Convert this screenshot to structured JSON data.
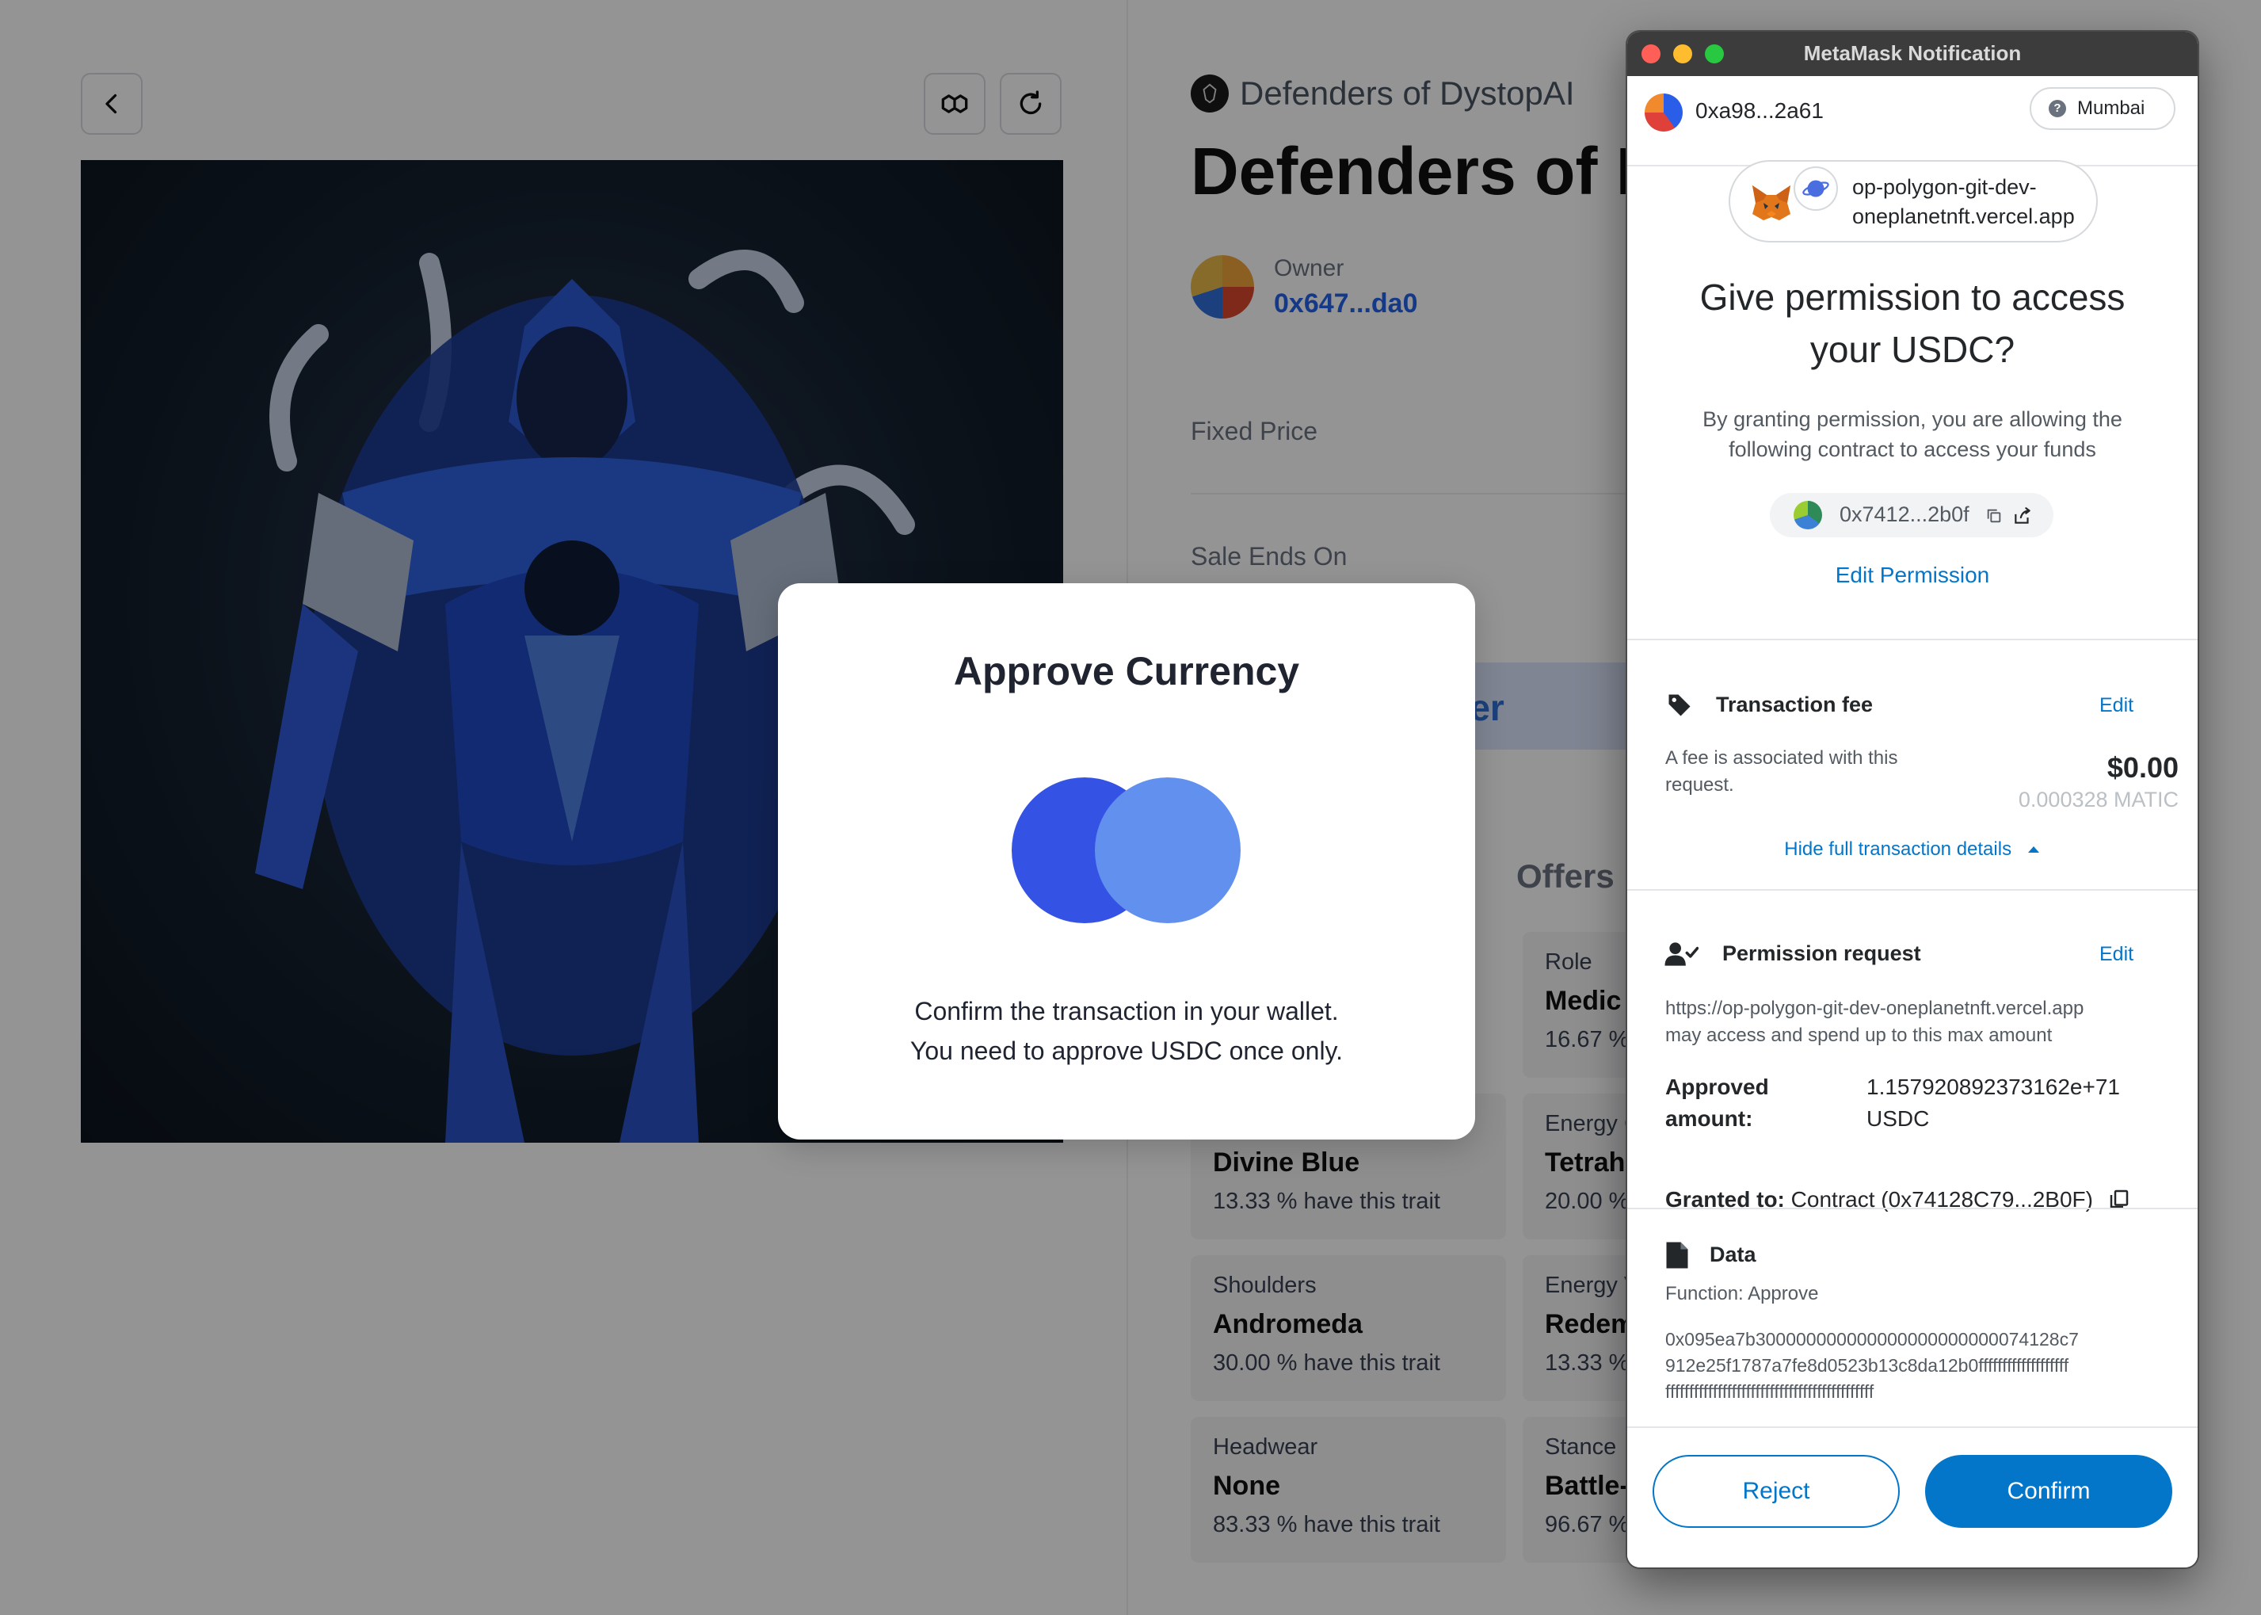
{
  "page": {
    "collection_name": "Defenders of DystopAI",
    "nft_title": "Defenders of D",
    "owner_label": "Owner",
    "owner_address": "0x647...da0",
    "fixed_price_label": "Fixed Price",
    "sale_ends_label": "Sale Ends On",
    "offer_button_partial": "fer",
    "tab_separator_partial": ":",
    "tab_offers": "Offers",
    "traits": [
      {
        "type": "Role",
        "value": "Medic",
        "pct": "16.67 %"
      },
      {
        "type": "",
        "value": "Divine Blue",
        "pct": "13.33 % have this trait"
      },
      {
        "type": "Energy C",
        "value": "Tetrahe",
        "pct": "20.00 %"
      },
      {
        "type": "Shoulders",
        "value": "Andromeda",
        "pct": "30.00 % have this trait"
      },
      {
        "type": "Energy V",
        "value": "Redem",
        "pct": "13.33 %"
      },
      {
        "type": "Headwear",
        "value": "None",
        "pct": "83.33 % have this trait"
      },
      {
        "type": "Stance",
        "value": "Battle-",
        "pct": "96.67 %"
      }
    ]
  },
  "approve_modal": {
    "title": "Approve Currency",
    "line1": "Confirm the transaction in your wallet.",
    "line2": "You need to approve USDC once only.",
    "color_left": "#3453e5",
    "color_right": "#6290ef"
  },
  "metamask": {
    "window_title": "MetaMask Notification",
    "account_address": "0xa98...2a61",
    "network_name": "Mumbai",
    "origin_line1": "op-polygon-git-dev-",
    "origin_line2": "oneplanetnft.vercel.app",
    "heading_line1": "Give permission to access",
    "heading_line2": "your USDC?",
    "description_line1": "By granting permission, you are allowing the",
    "description_line2": "following contract to access your funds",
    "contract_address": "0x7412...2b0f",
    "edit_permission": "Edit Permission",
    "fee": {
      "title": "Transaction fee",
      "edit": "Edit",
      "note_line1": "A fee is associated with this",
      "note_line2": "request.",
      "usd": "$0.00",
      "native": "0.000328 MATIC",
      "hide_details": "Hide full transaction details"
    },
    "permission": {
      "title": "Permission request",
      "edit": "Edit",
      "url": "https://op-polygon-git-dev-oneplanetnft.vercel.app",
      "url_note": "may access and spend up to this max amount",
      "approved_label_1": "Approved",
      "approved_label_2": "amount:",
      "approved_value_1": "1.157920892373162e+71",
      "approved_value_2": "USDC",
      "granted_label": "Granted to:",
      "granted_value": "Contract (0x74128C79...2B0F)"
    },
    "data": {
      "title": "Data",
      "function": "Function: Approve",
      "hex_line1": "0x095ea7b300000000000000000000000074128c7",
      "hex_line2": "912e25f1787a7fe8d0523b13c8da12b0fffffffffffffffffff",
      "hex_line3": "ffffffffffffffffffffffffffffffffffffffffffff"
    },
    "reject": "Reject",
    "confirm": "Confirm",
    "accent_color": "#0376c9"
  }
}
